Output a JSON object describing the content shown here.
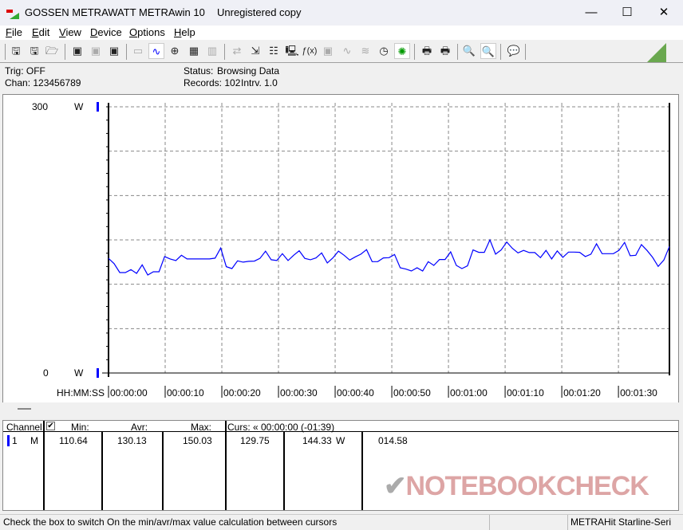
{
  "window": {
    "brand": "GOSSEN METRAWATT",
    "app": "METRAwin 10",
    "license": "Unregistered copy",
    "controls": [
      "minimize",
      "maximize",
      "close"
    ]
  },
  "menu": [
    "File",
    "Edit",
    "View",
    "Device",
    "Options",
    "Help"
  ],
  "toolbar": [
    "save-icon",
    "save-as-icon",
    "open-folder-icon",
    "device-read-icon",
    "device-read-disabled-icon",
    "device-memory-icon",
    "display-value-icon",
    "waveform-icon",
    "crosshair-icon",
    "table-icon",
    "bar-chart-icon",
    "transfer-icon",
    "import-icon",
    "data-list-icon",
    "monitor-icon",
    "function-icon",
    "device-transfer-icon",
    "waveform-disabled-icon",
    "multiwave-disabled-icon",
    "clock-icon",
    "bug-icon",
    "print-preview-icon",
    "print-icon",
    "zoom-multiwave-icon",
    "zoom-wave-icon",
    "comment-icon"
  ],
  "info": {
    "trig": "Trig: OFF",
    "chan": "Chan:  123456789",
    "status_label": "Status:",
    "status_value": "Browsing Data",
    "records": "Records: 102",
    "interval": "Intrv. 1.0"
  },
  "colors": {
    "series": "#0000ff",
    "channel_marker": "#0000ff",
    "accent": "#6aa84f"
  },
  "chart_data": {
    "type": "line",
    "ylim": [
      0,
      300
    ],
    "y_ticks": [
      "300",
      "0"
    ],
    "y_unit": "W",
    "x_label": "HH:MM:SS",
    "x_ticks": [
      "00:00:00",
      "00:00:10",
      "00:00:20",
      "00:00:30",
      "00:00:40",
      "00:00:50",
      "00:01:00",
      "00:01:10",
      "00:01:20",
      "00:01:30"
    ],
    "x_range_seconds": [
      0,
      99
    ],
    "grid": true,
    "series": [
      {
        "values": [
          129.2,
          123.2,
          113.2,
          113.2,
          116.5,
          112.3,
          121.9,
          110.5,
          114.1,
          114.1,
          131.2,
          128.5,
          126.7,
          132.7,
          128.5,
          128.5,
          128.5,
          128.5,
          128.5,
          129.4,
          140.8,
          119.8,
          117.7,
          126.4,
          124.9,
          125.8,
          126.1,
          129.2,
          137.3,
          127.6,
          126.7,
          134.5,
          126.7,
          132.7,
          137.8,
          129.2,
          127.6,
          129.7,
          135.4,
          124.0,
          129.7,
          137.3,
          132.7,
          127.3,
          130.9,
          133.9,
          139.0,
          125.5,
          125.5,
          129.7,
          130.0,
          133.6,
          118.6,
          117.1,
          115.0,
          118.6,
          115.0,
          125.5,
          121.3,
          127.9,
          127.9,
          136.5,
          121.3,
          117.7,
          120.7,
          138.7,
          136.0,
          136.0,
          150.0,
          133.9,
          138.7,
          147.6,
          140.5,
          135.4,
          138.1,
          135.7,
          135.7,
          130.0,
          138.1,
          128.5,
          137.5,
          130.3,
          136.3,
          136.3,
          136.0,
          131.2,
          133.9,
          145.6,
          134.5,
          134.5,
          134.5,
          138.1,
          147.1,
          132.1,
          132.7,
          144.7,
          138.1,
          130.3,
          120.1,
          127.3,
          142.6
        ]
      }
    ]
  },
  "table": {
    "channel_header": "Channel:",
    "checkbox_checked": true,
    "min_header": "Min:",
    "avr_header": "Avr:",
    "max_header": "Max:",
    "cursor_header": "Curs: « 00:00:00 (-01:39)",
    "row": {
      "channel": "1",
      "mode": "M",
      "min": "110.64",
      "avr": "130.13",
      "max": "150.03",
      "cursor1": "129.75",
      "cursor2": "144.33",
      "unit": "W",
      "diff": "014.58"
    }
  },
  "watermark": "NOTEBOOKCHECK",
  "statusbar": {
    "hint": "Check the box to switch On the min/avr/max value calculation between cursors",
    "device": "METRAHit Starline-Seri"
  }
}
